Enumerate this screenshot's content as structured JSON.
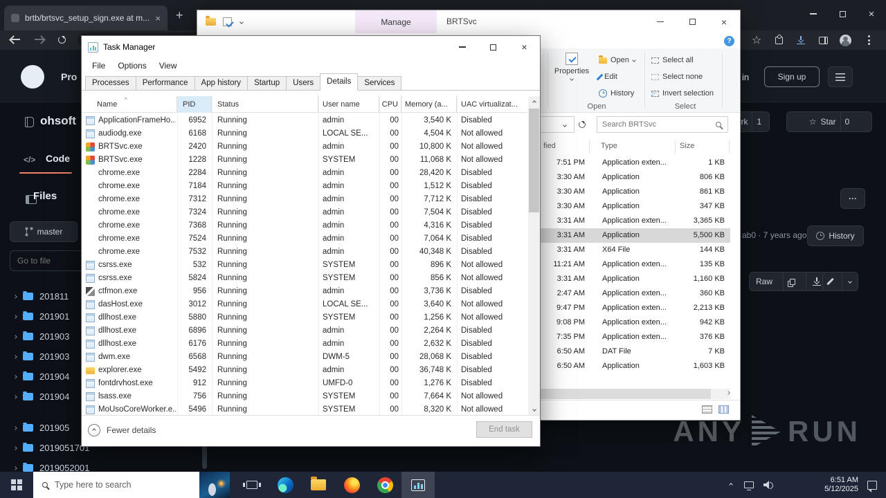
{
  "icons": {
    "close": "×",
    "plus": "+",
    "kebab": "···",
    "help": "?",
    "star": "☆",
    "code": "</>",
    "sort_asc": "^"
  },
  "browser": {
    "tab_title": "brtb/brtsvc_setup_sign.exe at m...",
    "github": {
      "nav_product_cut": "Pro",
      "sign_in_cut": "in",
      "sign_up": "Sign up",
      "repo_name": "ohsoft",
      "fork_label_cut": "ork",
      "fork_count": "1",
      "star_label": "Star",
      "star_count": "0",
      "code_tab": "Code",
      "files_title": "Files",
      "branch": "master",
      "goto_placeholder": "Go to file",
      "commit_meta": "ab0 · 7 years ago",
      "history_label": "History",
      "raw_label": "Raw",
      "tree": [
        {
          "label": "201811"
        },
        {
          "label": "201901"
        },
        {
          "label": "201903"
        },
        {
          "label": "201903"
        },
        {
          "label": "201904"
        },
        {
          "label": "201904"
        },
        {
          "label": "201905"
        },
        {
          "label": "2019051701"
        },
        {
          "label": "2019052001"
        }
      ]
    }
  },
  "explorer": {
    "manage_tab": "Manage",
    "title": "BRTSvc",
    "ribbon": {
      "properties": "Properties",
      "open": "Open",
      "edit": "Edit",
      "history": "History",
      "select_all": "Select all",
      "select_none": "Select none",
      "invert_selection": "Invert selection",
      "group_open": "Open",
      "group_select": "Select"
    },
    "search_placeholder": "Search BRTSvc",
    "columns": {
      "modified_cut": "fied",
      "type": "Type",
      "size": "Size"
    },
    "files": [
      {
        "time": "7:51 PM",
        "type": "Application exten...",
        "size": "1 KB",
        "selected": false
      },
      {
        "time": "3:30 AM",
        "type": "Application",
        "size": "806 KB",
        "selected": false
      },
      {
        "time": "3:30 AM",
        "type": "Application",
        "size": "861 KB",
        "selected": false
      },
      {
        "time": "3:30 AM",
        "type": "Application",
        "size": "347 KB",
        "selected": false
      },
      {
        "time": "3:31 AM",
        "type": "Application exten...",
        "size": "3,365 KB",
        "selected": false
      },
      {
        "time": "3:31 AM",
        "type": "Application",
        "size": "5,500 KB",
        "selected": true
      },
      {
        "time": "3:31 AM",
        "type": "X64 File",
        "size": "144 KB",
        "selected": false
      },
      {
        "time": "11:21 AM",
        "type": "Application exten...",
        "size": "135 KB",
        "selected": false
      },
      {
        "time": "3:31 AM",
        "type": "Application",
        "size": "1,160 KB",
        "selected": false
      },
      {
        "time": "2:47 AM",
        "type": "Application exten...",
        "size": "360 KB",
        "selected": false
      },
      {
        "time": "9:47 PM",
        "type": "Application exten...",
        "size": "2,213 KB",
        "selected": false
      },
      {
        "time": "9:08 PM",
        "type": "Application exten...",
        "size": "942 KB",
        "selected": false
      },
      {
        "time": "7:35 PM",
        "type": "Application exten...",
        "size": "376 KB",
        "selected": false
      },
      {
        "time": "6:50 AM",
        "type": "DAT File",
        "size": "7 KB",
        "selected": false
      },
      {
        "time": "6:50 AM",
        "type": "Application",
        "size": "1,603 KB",
        "selected": false
      }
    ]
  },
  "task_manager": {
    "title": "Task Manager",
    "menu": [
      "File",
      "Options",
      "View"
    ],
    "tabs": [
      {
        "label": "Processes",
        "active": false
      },
      {
        "label": "Performance",
        "active": false
      },
      {
        "label": "App history",
        "active": false
      },
      {
        "label": "Startup",
        "active": false
      },
      {
        "label": "Users",
        "active": false
      },
      {
        "label": "Details",
        "active": true
      },
      {
        "label": "Services",
        "active": false
      }
    ],
    "columns": [
      "Name",
      "PID",
      "Status",
      "User name",
      "CPU",
      "Memory (a...",
      "UAC virtualizat..."
    ],
    "processes": [
      {
        "icon": "app",
        "name": "ApplicationFrameHo...",
        "pid": "6952",
        "status": "Running",
        "user": "admin",
        "cpu": "00",
        "mem": "3,540 K",
        "uac": "Disabled"
      },
      {
        "icon": "app",
        "name": "audiodg.exe",
        "pid": "6168",
        "status": "Running",
        "user": "LOCAL SE...",
        "cpu": "00",
        "mem": "4,504 K",
        "uac": "Not allowed"
      },
      {
        "icon": "brt",
        "name": "BRTSvc.exe",
        "pid": "2420",
        "status": "Running",
        "user": "admin",
        "cpu": "00",
        "mem": "10,800 K",
        "uac": "Not allowed"
      },
      {
        "icon": "brt",
        "name": "BRTSvc.exe",
        "pid": "1228",
        "status": "Running",
        "user": "SYSTEM",
        "cpu": "00",
        "mem": "11,068 K",
        "uac": "Not allowed"
      },
      {
        "icon": "chrome",
        "name": "chrome.exe",
        "pid": "2284",
        "status": "Running",
        "user": "admin",
        "cpu": "00",
        "mem": "28,420 K",
        "uac": "Disabled"
      },
      {
        "icon": "chrome",
        "name": "chrome.exe",
        "pid": "7184",
        "status": "Running",
        "user": "admin",
        "cpu": "00",
        "mem": "1,512 K",
        "uac": "Disabled"
      },
      {
        "icon": "chrome",
        "name": "chrome.exe",
        "pid": "7312",
        "status": "Running",
        "user": "admin",
        "cpu": "00",
        "mem": "7,712 K",
        "uac": "Disabled"
      },
      {
        "icon": "chrome",
        "name": "chrome.exe",
        "pid": "7324",
        "status": "Running",
        "user": "admin",
        "cpu": "00",
        "mem": "7,504 K",
        "uac": "Disabled"
      },
      {
        "icon": "chrome",
        "name": "chrome.exe",
        "pid": "7368",
        "status": "Running",
        "user": "admin",
        "cpu": "00",
        "mem": "4,316 K",
        "uac": "Disabled"
      },
      {
        "icon": "chrome",
        "name": "chrome.exe",
        "pid": "7524",
        "status": "Running",
        "user": "admin",
        "cpu": "00",
        "mem": "7,064 K",
        "uac": "Disabled"
      },
      {
        "icon": "chrome",
        "name": "chrome.exe",
        "pid": "7532",
        "status": "Running",
        "user": "admin",
        "cpu": "00",
        "mem": "40,348 K",
        "uac": "Disabled"
      },
      {
        "icon": "app",
        "name": "csrss.exe",
        "pid": "532",
        "status": "Running",
        "user": "SYSTEM",
        "cpu": "00",
        "mem": "896 K",
        "uac": "Not allowed"
      },
      {
        "icon": "app",
        "name": "csrss.exe",
        "pid": "5824",
        "status": "Running",
        "user": "SYSTEM",
        "cpu": "00",
        "mem": "856 K",
        "uac": "Not allowed"
      },
      {
        "icon": "pen",
        "name": "ctfmon.exe",
        "pid": "956",
        "status": "Running",
        "user": "admin",
        "cpu": "00",
        "mem": "3,736 K",
        "uac": "Disabled"
      },
      {
        "icon": "app",
        "name": "dasHost.exe",
        "pid": "3012",
        "status": "Running",
        "user": "LOCAL SE...",
        "cpu": "00",
        "mem": "3,640 K",
        "uac": "Not allowed"
      },
      {
        "icon": "app",
        "name": "dllhost.exe",
        "pid": "5880",
        "status": "Running",
        "user": "SYSTEM",
        "cpu": "00",
        "mem": "1,256 K",
        "uac": "Not allowed"
      },
      {
        "icon": "app",
        "name": "dllhost.exe",
        "pid": "6896",
        "status": "Running",
        "user": "admin",
        "cpu": "00",
        "mem": "2,264 K",
        "uac": "Disabled"
      },
      {
        "icon": "app",
        "name": "dllhost.exe",
        "pid": "6176",
        "status": "Running",
        "user": "admin",
        "cpu": "00",
        "mem": "2,632 K",
        "uac": "Disabled"
      },
      {
        "icon": "app",
        "name": "dwm.exe",
        "pid": "6568",
        "status": "Running",
        "user": "DWM-5",
        "cpu": "00",
        "mem": "28,068 K",
        "uac": "Disabled"
      },
      {
        "icon": "folder",
        "name": "explorer.exe",
        "pid": "5492",
        "status": "Running",
        "user": "admin",
        "cpu": "00",
        "mem": "36,748 K",
        "uac": "Disabled"
      },
      {
        "icon": "app",
        "name": "fontdrvhost.exe",
        "pid": "912",
        "status": "Running",
        "user": "UMFD-0",
        "cpu": "00",
        "mem": "1,276 K",
        "uac": "Disabled"
      },
      {
        "icon": "app",
        "name": "lsass.exe",
        "pid": "756",
        "status": "Running",
        "user": "SYSTEM",
        "cpu": "00",
        "mem": "7,664 K",
        "uac": "Not allowed"
      },
      {
        "icon": "app",
        "name": "MoUsoCoreWorker.e...",
        "pid": "5496",
        "status": "Running",
        "user": "SYSTEM",
        "cpu": "00",
        "mem": "8,320 K",
        "uac": "Not allowed"
      }
    ],
    "footer": {
      "fewer_details": "Fewer details",
      "end_task": "End task"
    }
  },
  "taskbar": {
    "search_placeholder": "Type here to search",
    "time": "6:51 AM",
    "date": "5/12/2025"
  },
  "watermark": {
    "left": "ANY",
    "right": "RUN"
  }
}
